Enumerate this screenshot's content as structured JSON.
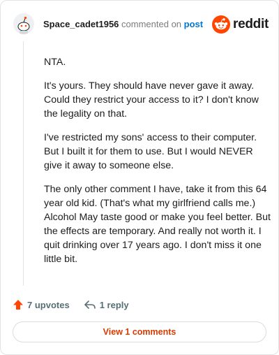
{
  "comment": {
    "username": "Space_cadet1956",
    "action_text": "commented on",
    "post_link": "post",
    "paragraphs": [
      "NTA.",
      "It's yours. They should have never gave it away. Could they restrict your access to it? I don't know the legality on that.",
      "I've restricted my sons' access to their computer. But I built it for them to use. But I would NEVER give it away to someone else.",
      "The only other comment I have, take it from this 64 year old kid. (That's what my girlfriend calls me.) Alcohol May taste good or make you feel better. But the effects are temporary. And really not worth it. I quit drinking over 17 years ago. I don't miss it one little bit."
    ]
  },
  "brand": {
    "wordmark": "reddit",
    "icon": "reddit-snoo-icon",
    "color": "#ff4500"
  },
  "actions": {
    "upvotes_label": "7 upvotes",
    "upvote_icon": "upvote-arrow-icon",
    "upvote_color": "#ff4500",
    "reply_label": "1 reply",
    "reply_icon": "reply-icon"
  },
  "footer": {
    "view_comments_label": "View 1 comments",
    "accent": "#d93a00"
  }
}
